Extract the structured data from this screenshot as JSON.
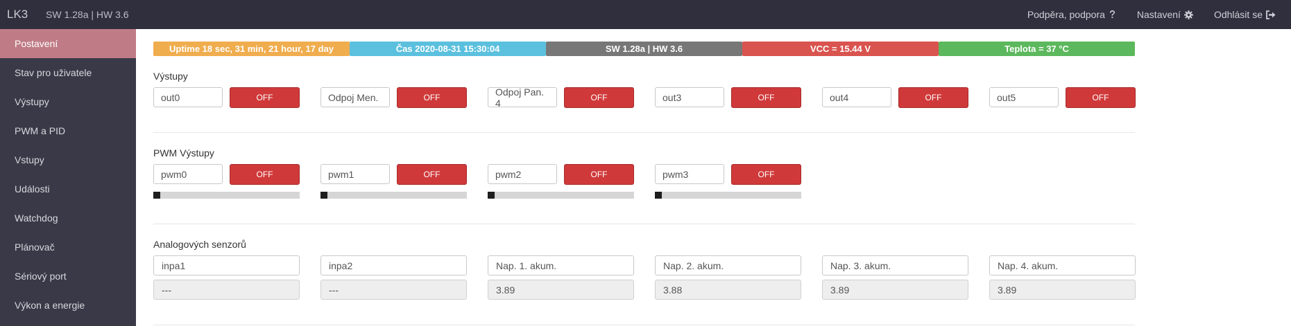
{
  "header": {
    "brand": "LK3",
    "hw_info": "SW 1.28a | HW 3.6",
    "nav": [
      {
        "label": "Podpěra, podpora",
        "icon": "question-icon"
      },
      {
        "label": "Nastavení",
        "icon": "gear-icon"
      },
      {
        "label": "Odhlásit se",
        "icon": "sign-out-icon"
      }
    ]
  },
  "sidebar": {
    "items": [
      {
        "label": "Postavení",
        "active": true
      },
      {
        "label": "Stav pro uživatele"
      },
      {
        "label": "Výstupy"
      },
      {
        "label": "PWM a PID"
      },
      {
        "label": "Vstupy"
      },
      {
        "label": "Události"
      },
      {
        "label": "Watchdog"
      },
      {
        "label": "Plánovač"
      },
      {
        "label": "Sériový port"
      },
      {
        "label": "Výkon a energie"
      }
    ]
  },
  "status": {
    "uptime": "Uptime 18 sec, 31 min, 21 hour, 17 day",
    "time": "Čas 2020-08-31 15:30:04",
    "sw": "SW 1.28a | HW 3.6",
    "vcc": "VCC = 15.44 V",
    "temp": "Teplota = 37 °C"
  },
  "colors": {
    "uptime": "#f0ad4e",
    "time": "#5bc0de",
    "sw": "#777777",
    "vcc": "#d9534f",
    "temp": "#5cb85c",
    "off_button": "#d0393a",
    "sidebar_active": "#c07c86"
  },
  "outputs": {
    "title": "Výstupy",
    "items": [
      {
        "name": "out0",
        "state": "OFF"
      },
      {
        "name": "Odpoj Men.",
        "state": "OFF"
      },
      {
        "name": "Odpoj Pan. 4",
        "state": "OFF"
      },
      {
        "name": "out3",
        "state": "OFF"
      },
      {
        "name": "out4",
        "state": "OFF"
      },
      {
        "name": "out5",
        "state": "OFF"
      }
    ]
  },
  "pwm": {
    "title": "PWM Výstupy",
    "items": [
      {
        "name": "pwm0",
        "state": "OFF",
        "level": 0
      },
      {
        "name": "pwm1",
        "state": "OFF",
        "level": 0
      },
      {
        "name": "pwm2",
        "state": "OFF",
        "level": 0
      },
      {
        "name": "pwm3",
        "state": "OFF",
        "level": 0
      }
    ]
  },
  "analog": {
    "title": "Analogových senzorů",
    "items": [
      {
        "name": "inpa1",
        "value": "---"
      },
      {
        "name": "inpa2",
        "value": "---"
      },
      {
        "name": "Nap. 1. akum.",
        "value": "3.89"
      },
      {
        "name": "Nap. 2. akum.",
        "value": "3.88"
      },
      {
        "name": "Nap. 3. akum.",
        "value": "3.89"
      },
      {
        "name": "Nap. 4. akum.",
        "value": "3.89"
      }
    ]
  }
}
